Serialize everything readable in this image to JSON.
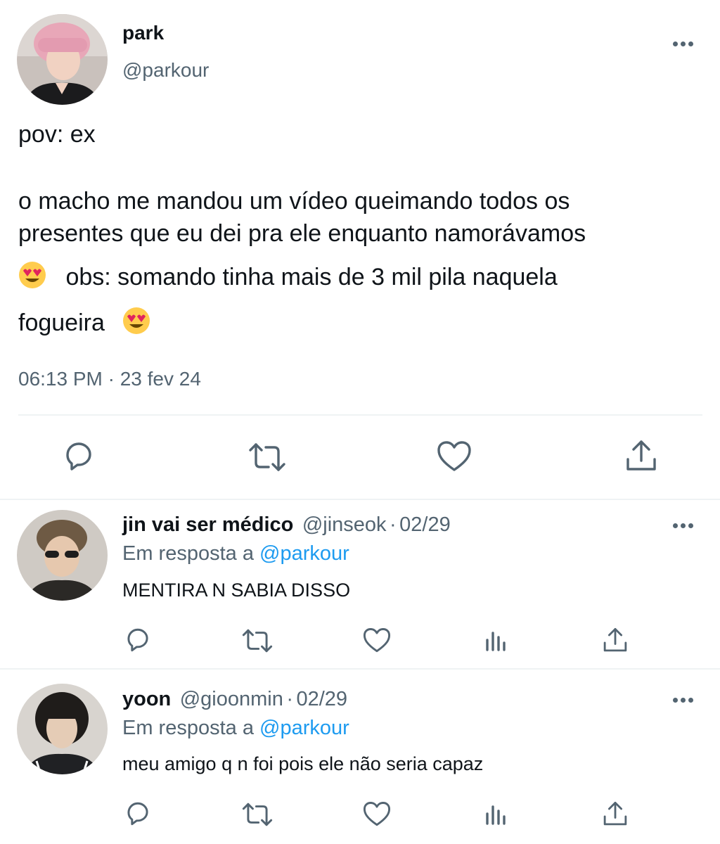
{
  "main_tweet": {
    "author_name": "park",
    "author_handle": "@parkour",
    "text_line1": "pov: ex",
    "text_line2": "o macho me mandou um vídeo queimando todos os",
    "text_line3": "presentes que eu dei pra ele enquanto namorávamos",
    "text_line4": "obs: somando tinha mais de 3 mil pila naquela",
    "text_line5": "fogueira",
    "timestamp": "06:13 PM · 23 fev 24",
    "emoji_name": "heart-eyes-emoji"
  },
  "replies": [
    {
      "author_name": "jin vai ser médico",
      "author_handle": "@jinseok",
      "separator": "·",
      "date": "02/29",
      "reply_prefix": "Em resposta a",
      "reply_to": "@parkour",
      "text": "MENTIRA N SABIA DISSO"
    },
    {
      "author_name": "yoon",
      "author_handle": "@gioonmin",
      "separator": "·",
      "date": "02/29",
      "reply_prefix": "Em resposta a",
      "reply_to": "@parkour",
      "text": "meu amigo q n foi pois ele não seria capaz"
    }
  ],
  "colors": {
    "text": "#0f1419",
    "secondary": "#536471",
    "link": "#1d9bf0",
    "divider": "#eff3f4"
  }
}
